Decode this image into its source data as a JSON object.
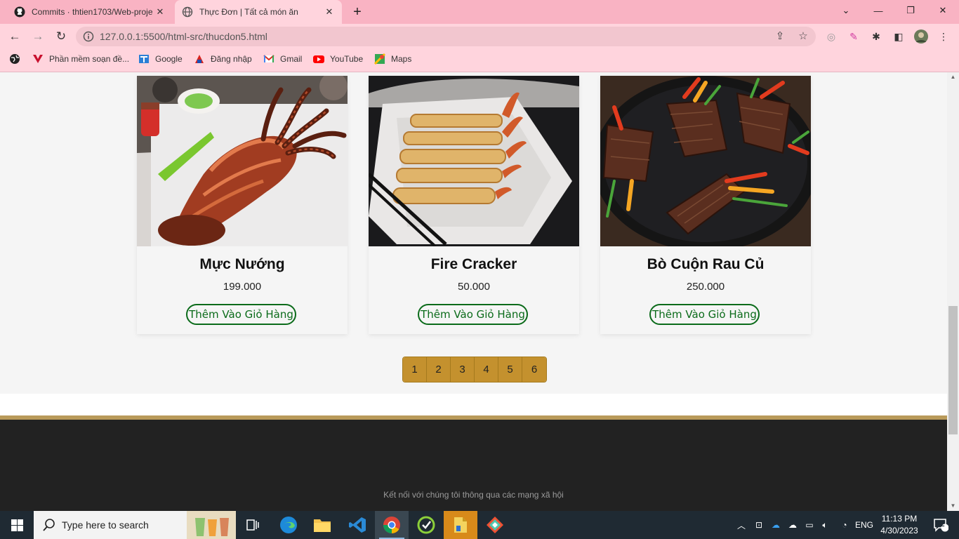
{
  "browser": {
    "tabs": [
      {
        "label": "Commits · thtien1703/Web-proje",
        "icon": "github-icon",
        "active": false
      },
      {
        "label": "Thực Đơn | Tất cả món ăn",
        "icon": "globe-icon",
        "active": true
      }
    ],
    "new_tab": "+",
    "window_controls": {
      "minimize": "—",
      "restore": "❐",
      "close": "✕",
      "tab_search": "⌄"
    },
    "address": {
      "url": "127.0.0.1:5500/html-src/thucdon5.html"
    },
    "bookmarks": [
      {
        "label": "Phần mềm soạn đề...",
        "icon": "v-logo-icon"
      },
      {
        "label": "Google",
        "icon": "google-icon"
      },
      {
        "label": "Đăng nhập",
        "icon": "login-logo-icon"
      },
      {
        "label": "Gmail",
        "icon": "gmail-icon"
      },
      {
        "label": "YouTube",
        "icon": "youtube-icon"
      },
      {
        "label": "Maps",
        "icon": "maps-icon"
      }
    ]
  },
  "menu": {
    "dishes": [
      {
        "name": "Mực Nướng",
        "price": "199.000",
        "button": "Thêm Vào Giỏ Hàng",
        "image": "grilled-squid"
      },
      {
        "name": "Fire Cracker",
        "price": "50.000",
        "button": "Thêm Vào Giỏ Hàng",
        "image": "shrimp-spring-rolls"
      },
      {
        "name": "Bò Cuộn Rau Củ",
        "price": "250.000",
        "button": "Thêm Vào Giỏ Hàng",
        "image": "beef-vegetable-rolls"
      }
    ],
    "pagination": [
      "1",
      "2",
      "3",
      "4",
      "5",
      "6"
    ]
  },
  "footer": {
    "social_text": "Kết nối với chúng tôi thông qua các mạng xã hội"
  },
  "taskbar": {
    "search_placeholder": "Type here to search",
    "apps": [
      "task-view",
      "edge",
      "file-explorer",
      "vscode",
      "chrome",
      "app-green",
      "app-orange",
      "app-git"
    ],
    "tray": {
      "language": "ENG",
      "time": "11:13 PM",
      "date": "4/30/2023",
      "notifications": "2"
    }
  },
  "colors": {
    "tab_strip": "#f9b3c3",
    "toolbar": "#ffd4dd",
    "accent_green": "#0b6b1a",
    "pagination": "#c4912e",
    "footer": "#222222",
    "footer_border": "#b99a5a",
    "taskbar": "#1f2a33"
  }
}
